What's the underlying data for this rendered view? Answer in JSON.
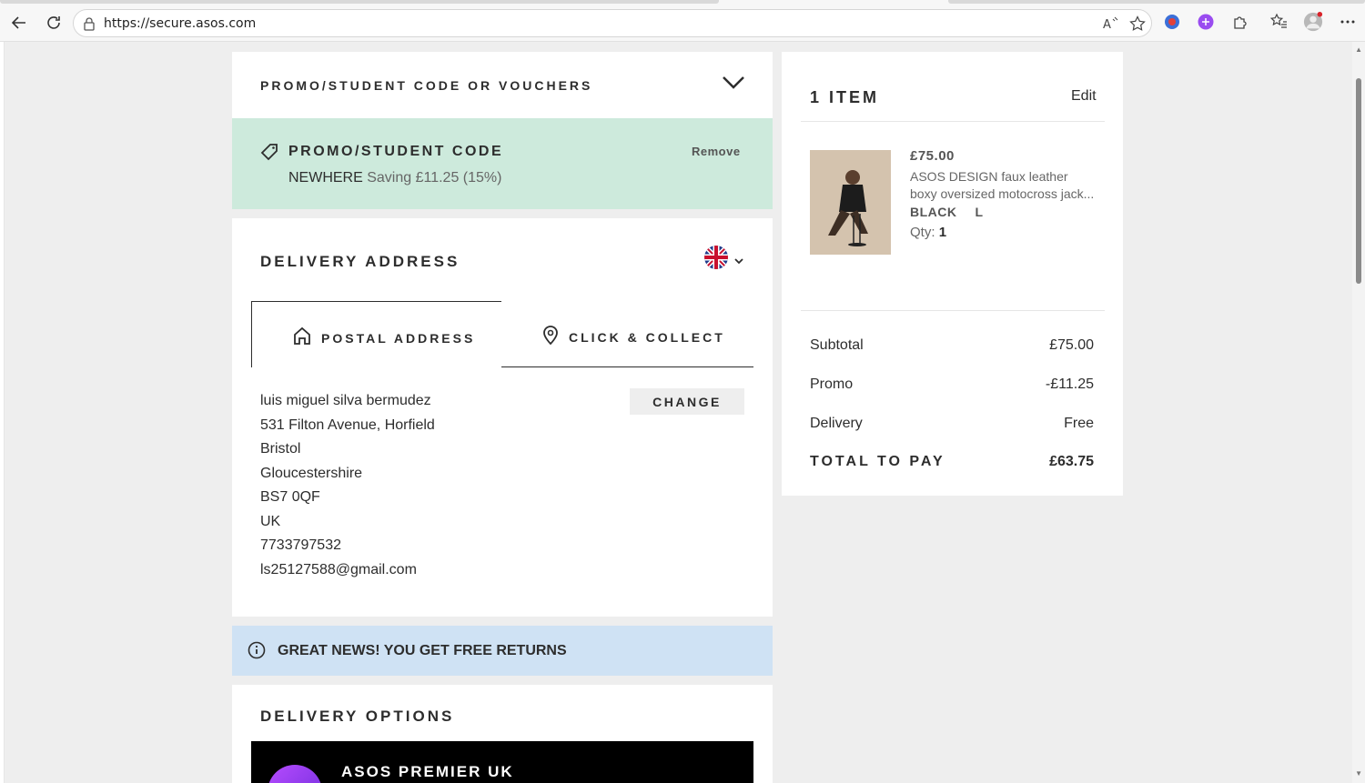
{
  "browser": {
    "url": "https://secure.asos.com"
  },
  "promo_section": {
    "toggle_label": "PROMO/STUDENT CODE OR VOUCHERS",
    "applied_title": "PROMO/STUDENT CODE",
    "remove_label": "Remove",
    "code": "NEWHERE",
    "saving_text": "Saving £11.25 (15%)"
  },
  "delivery_address": {
    "heading": "DELIVERY ADDRESS",
    "country_flag": "uk-flag-icon",
    "tabs": [
      {
        "label": "POSTAL ADDRESS",
        "icon": "house-icon",
        "selected": true
      },
      {
        "label": "CLICK & COLLECT",
        "icon": "location-pin-icon",
        "selected": false
      }
    ],
    "address_lines": [
      "luis miguel silva bermudez",
      "531 Filton Avenue, Horfield",
      "Bristol",
      "Gloucestershire",
      "BS7 0QF",
      "UK",
      "7733797532",
      "ls25127588@gmail.com"
    ],
    "change_label": "CHANGE"
  },
  "notice": {
    "text": "GREAT NEWS! YOU GET FREE RETURNS"
  },
  "delivery_options": {
    "heading": "DELIVERY OPTIONS",
    "premier_label": "ASOS PREMIER UK"
  },
  "summary": {
    "item_count_label": "1 ITEM",
    "edit_label": "Edit",
    "item": {
      "price": "£75.00",
      "name_line1": "ASOS DESIGN faux leather",
      "name_line2": "boxy oversized motocross jack...",
      "color": "BLACK",
      "size": "L",
      "qty_label": "Qty:",
      "qty": "1"
    },
    "rows": [
      {
        "label": "Subtotal",
        "value": "£75.00"
      },
      {
        "label": "Promo",
        "value": "-£11.25"
      },
      {
        "label": "Delivery",
        "value": "Free"
      }
    ],
    "total_label": "TOTAL TO PAY",
    "total_value": "£63.75"
  },
  "colors": {
    "promo_bg": "#cdeadc",
    "notice_bg": "#cfe2f4",
    "page_bg": "#eeeeee",
    "text": "#2d2d2d"
  }
}
